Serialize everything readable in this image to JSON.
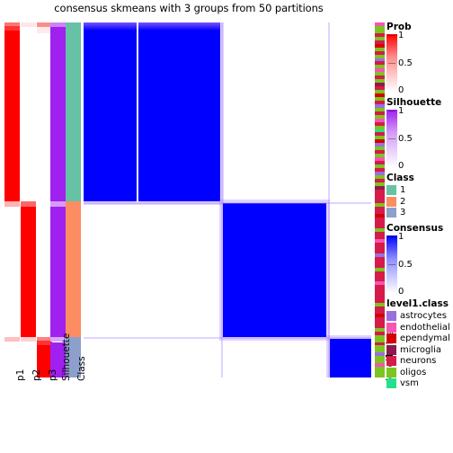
{
  "title": "consensus skmeans with 3 groups from 50 partitions",
  "column_labels": [
    "p1",
    "p2",
    "p3",
    "Silhouette",
    "Class"
  ],
  "right_label": "level1.class",
  "legends": {
    "prob": {
      "title": "Prob",
      "ticks": [
        "1",
        "0.5",
        "0"
      ],
      "low_color": "#ffffff",
      "high_color": "#ff0000"
    },
    "silhouette": {
      "title": "Silhouette",
      "ticks": [
        "1",
        "0.5",
        "0"
      ],
      "low_color": "#ffffff",
      "high_color": "#a020f0"
    },
    "class": {
      "title": "Class",
      "items": [
        {
          "label": "1",
          "color": "#66c2a5"
        },
        {
          "label": "2",
          "color": "#fc8d62"
        },
        {
          "label": "3",
          "color": "#8da0cb"
        }
      ]
    },
    "consensus": {
      "title": "Consensus",
      "ticks": [
        "1",
        "0.5",
        "0"
      ],
      "low_color": "#ffffff",
      "high_color": "#0000ff"
    },
    "level1_class": {
      "title": "level1.class",
      "items": [
        {
          "label": "astrocytes",
          "color": "#9a6fe0"
        },
        {
          "label": "endothelial",
          "color": "#f754b4"
        },
        {
          "label": "ependymal",
          "color": "#d40000"
        },
        {
          "label": "microglia",
          "color": "#8c1a4b"
        },
        {
          "label": "neurons",
          "color": "#d41b4a"
        },
        {
          "label": "oligos",
          "color": "#7cc420"
        },
        {
          "label": "vsm",
          "color": "#25e08a"
        }
      ]
    }
  },
  "chart_data": {
    "type": "heatmap",
    "title": "consensus skmeans with 3 groups from 50 partitions",
    "method": "skmeans",
    "k_groups": 3,
    "n_partitions": 50,
    "n_samples": 100,
    "value_name": "Consensus",
    "value_range": [
      0,
      1
    ],
    "grid": false,
    "legend_position": "right",
    "class_assignment": {
      "classes": [
        1,
        2,
        3
      ],
      "class_sizes": [
        48,
        36,
        16
      ],
      "class_colors": [
        "#66c2a5",
        "#fc8d62",
        "#8da0cb"
      ]
    },
    "consensus_blocks": [
      {
        "class": 1,
        "row_start_frac": 0.0,
        "row_end_frac": 0.505,
        "col_start_frac": 0.0,
        "col_end_frac": 0.475,
        "value": 1.0
      },
      {
        "class": 2,
        "row_start_frac": 0.508,
        "row_end_frac": 0.885,
        "col_start_frac": 0.483,
        "col_end_frac": 0.845,
        "value": 1.0
      },
      {
        "class": 3,
        "row_start_frac": 0.89,
        "row_end_frac": 1.0,
        "col_start_frac": 0.855,
        "col_end_frac": 1.0,
        "value": 1.0
      }
    ],
    "off_block_value": 0.0,
    "row_annotations": [
      {
        "name": "p1",
        "type": "continuous",
        "range": [
          0,
          1
        ],
        "palette": [
          "#ffffff",
          "#ff0000"
        ],
        "segments": [
          {
            "row_start_frac": 0.0,
            "row_end_frac": 0.01,
            "value": 0.55
          },
          {
            "row_start_frac": 0.01,
            "row_end_frac": 0.022,
            "value": 0.8
          },
          {
            "row_start_frac": 0.022,
            "row_end_frac": 0.505,
            "value": 1.0
          },
          {
            "row_start_frac": 0.505,
            "row_end_frac": 0.52,
            "value": 0.3
          },
          {
            "row_start_frac": 0.52,
            "row_end_frac": 0.885,
            "value": 0.0
          },
          {
            "row_start_frac": 0.885,
            "row_end_frac": 0.9,
            "value": 0.25
          },
          {
            "row_start_frac": 0.9,
            "row_end_frac": 1.0,
            "value": 0.0
          }
        ]
      },
      {
        "name": "p2",
        "type": "continuous",
        "range": [
          0,
          1
        ],
        "palette": [
          "#ffffff",
          "#ff0000"
        ],
        "segments": [
          {
            "row_start_frac": 0.0,
            "row_end_frac": 0.012,
            "value": 0.1
          },
          {
            "row_start_frac": 0.012,
            "row_end_frac": 0.505,
            "value": 0.0
          },
          {
            "row_start_frac": 0.505,
            "row_end_frac": 0.518,
            "value": 0.6
          },
          {
            "row_start_frac": 0.518,
            "row_end_frac": 0.885,
            "value": 1.0
          },
          {
            "row_start_frac": 0.885,
            "row_end_frac": 0.9,
            "value": 0.18
          },
          {
            "row_start_frac": 0.9,
            "row_end_frac": 1.0,
            "value": 0.0
          }
        ]
      },
      {
        "name": "p3",
        "type": "continuous",
        "range": [
          0,
          1
        ],
        "palette": [
          "#ffffff",
          "#ff0000"
        ],
        "segments": [
          {
            "row_start_frac": 0.0,
            "row_end_frac": 0.012,
            "value": 0.45
          },
          {
            "row_start_frac": 0.012,
            "row_end_frac": 0.03,
            "value": 0.08
          },
          {
            "row_start_frac": 0.03,
            "row_end_frac": 0.885,
            "value": 0.0
          },
          {
            "row_start_frac": 0.885,
            "row_end_frac": 0.897,
            "value": 0.5
          },
          {
            "row_start_frac": 0.897,
            "row_end_frac": 0.908,
            "value": 0.8
          },
          {
            "row_start_frac": 0.908,
            "row_end_frac": 1.0,
            "value": 1.0
          }
        ]
      },
      {
        "name": "Silhouette",
        "type": "continuous",
        "range": [
          0,
          1
        ],
        "palette": [
          "#ffffff",
          "#a020f0"
        ],
        "segments": [
          {
            "row_start_frac": 0.0,
            "row_end_frac": 0.012,
            "value": 0.55
          },
          {
            "row_start_frac": 0.012,
            "row_end_frac": 0.505,
            "value": 1.0
          },
          {
            "row_start_frac": 0.505,
            "row_end_frac": 0.518,
            "value": 0.45
          },
          {
            "row_start_frac": 0.518,
            "row_end_frac": 0.885,
            "value": 1.0
          },
          {
            "row_start_frac": 0.885,
            "row_end_frac": 0.9,
            "value": 0.4
          },
          {
            "row_start_frac": 0.9,
            "row_end_frac": 1.0,
            "value": 1.0
          }
        ]
      },
      {
        "name": "Class",
        "type": "discrete",
        "segments": [
          {
            "row_start_frac": 0.0,
            "row_end_frac": 0.505,
            "label": "1",
            "color": "#66c2a5"
          },
          {
            "row_start_frac": 0.505,
            "row_end_frac": 0.885,
            "label": "2",
            "color": "#fc8d62"
          },
          {
            "row_start_frac": 0.885,
            "row_end_frac": 1.0,
            "label": "3",
            "color": "#8da0cb"
          }
        ]
      }
    ],
    "right_annotation": {
      "name": "level1.class",
      "type": "discrete",
      "categories": [
        "astrocytes",
        "endothelial",
        "ependymal",
        "microglia",
        "neurons",
        "oligos",
        "vsm"
      ],
      "category_colors": [
        "#9a6fe0",
        "#f754b4",
        "#d40000",
        "#8c1a4b",
        "#d41b4a",
        "#7cc420",
        "#25e08a"
      ],
      "values": [
        "endothelial",
        "oligos",
        "oligos",
        "neurons",
        "oligos",
        "neurons",
        "ependymal",
        "oligos",
        "neurons",
        "oligos",
        "astrocytes",
        "neurons",
        "oligos",
        "endothelial",
        "oligos",
        "neurons",
        "oligos",
        "microglia",
        "neurons",
        "oligos",
        "ependymal",
        "oligos",
        "neurons",
        "astrocytes",
        "oligos",
        "neurons",
        "oligos",
        "endothelial",
        "neurons",
        "oligos",
        "vsm",
        "neurons",
        "oligos",
        "ependymal",
        "astrocytes",
        "oligos",
        "neurons",
        "oligos",
        "endothelial",
        "neurons",
        "oligos",
        "neurons",
        "astrocytes",
        "oligos",
        "neurons",
        "oligos",
        "microglia",
        "neurons",
        "neurons",
        "neurons",
        "neurons",
        "oligos",
        "neurons",
        "neurons",
        "ependymal",
        "neurons",
        "neurons",
        "neurons",
        "oligos",
        "neurons",
        "neurons",
        "endothelial",
        "neurons",
        "neurons",
        "neurons",
        "astrocytes",
        "neurons",
        "neurons",
        "neurons",
        "oligos",
        "neurons",
        "neurons",
        "neurons",
        "endothelial",
        "neurons",
        "neurons",
        "neurons",
        "neurons",
        "neurons",
        "oligos",
        "neurons",
        "neurons",
        "ependymal",
        "neurons",
        "neurons",
        "neurons",
        "oligos",
        "neurons",
        "oligos",
        "oligos",
        "neurons",
        "oligos",
        "oligos",
        "astrocytes",
        "oligos",
        "oligos",
        "endothelial",
        "oligos",
        "oligos",
        "oligos"
      ]
    }
  }
}
